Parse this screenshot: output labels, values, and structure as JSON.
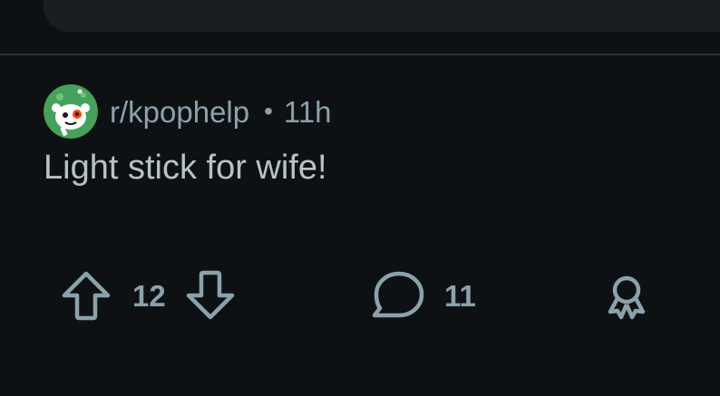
{
  "post": {
    "subreddit": "r/kpophelp",
    "separator": "•",
    "age": "11h",
    "title": "Light stick for wife!"
  },
  "actions": {
    "vote_count": "12",
    "comment_count": "11"
  },
  "icons": {
    "upvote": "arrow-up-outline-icon",
    "downvote": "arrow-down-outline-icon",
    "comment": "speech-bubble-icon",
    "award": "award-ribbon-icon",
    "avatar": "snoo-avatar-icon"
  },
  "colors": {
    "background": "#0e1113",
    "meta_text": "#8ba2ad",
    "title_text": "#b7c3c9",
    "divider": "#2b3134",
    "avatar_green": "#46a15a"
  }
}
